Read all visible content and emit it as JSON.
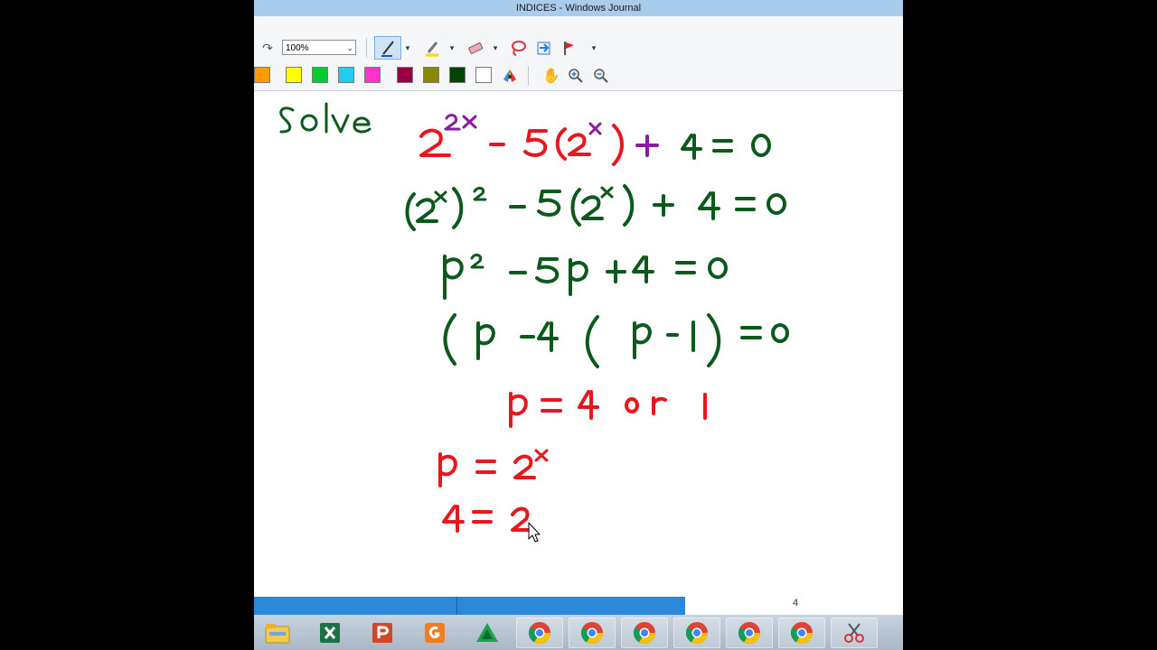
{
  "window": {
    "title": "INDICES - Windows Journal"
  },
  "toolbar": {
    "zoom": "100%",
    "tools": [
      "undo-arrow",
      "pen",
      "pen-dropdown",
      "highlighter",
      "highlighter-dropdown",
      "eraser",
      "eraser-dropdown",
      "lasso",
      "insert-space",
      "flag",
      "flag-dropdown"
    ],
    "colors": [
      "#ff9900",
      "#ffff00",
      "#00cc33",
      "#22ccee",
      "#ff33cc",
      "#990044",
      "#888800",
      "#004400",
      "#ffffff"
    ],
    "view_tools": [
      "pan-hand",
      "zoom-in",
      "zoom-out"
    ]
  },
  "note": {
    "heading": "Solve",
    "lines": [
      "2^{2x} - 5(2^x) + 4 = 0",
      "(2^x)^2 - 5(2^x) + 4 = 0",
      "p^2 - 5p + 4 = 0",
      "(p - 4)(p - 1) = 0",
      "p = 4 or 1",
      "p = 2^x",
      "4 = 2"
    ],
    "colors": {
      "green": "#0b5a1c",
      "red": "#e8171d",
      "purple": "#8a1aa0"
    }
  },
  "status": {
    "page_number": "4"
  },
  "taskbar": {
    "apps": [
      "file-explorer",
      "excel",
      "powerpoint",
      "foxit",
      "app-green-triangle",
      "chrome-1",
      "chrome-2",
      "chrome-3",
      "chrome-4",
      "chrome-5",
      "chrome-6",
      "snipping-tool"
    ]
  }
}
